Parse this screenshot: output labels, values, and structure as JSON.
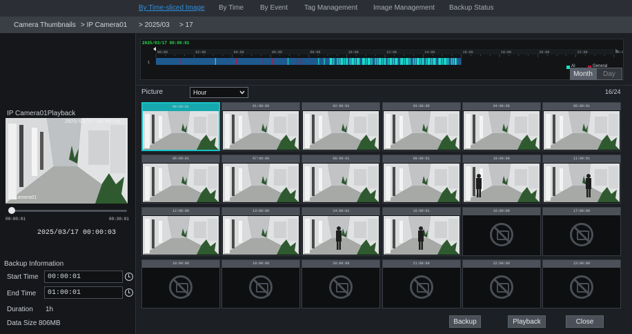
{
  "tabs": [
    "By Time-sliced Image",
    "By Time",
    "By Event",
    "Tag Management",
    "Image Management",
    "Backup Status"
  ],
  "breadcrumb": [
    "Camera Thumbnails",
    "> IP Camera01",
    "> 2025/03",
    "> 17"
  ],
  "preview": {
    "title": "IP Camera01Playback",
    "osd_time": "2025/03/17 00:00:10",
    "osd_cam": "IP Camera01",
    "progress_start": "00:00:01",
    "progress_end": "00:30:01",
    "progress_fraction": 0.0,
    "current_time": "2025/03/17 00:00:03"
  },
  "backup": {
    "heading": "Backup Information",
    "start_label": "Start Time",
    "start_value": "00:00:01",
    "end_label": "End Time",
    "end_value": "01:00:01",
    "duration_label": "Duration",
    "duration_value": "1h",
    "size_label": "Data Size",
    "size_value": "806MB"
  },
  "timeline": {
    "current_time": "2025/03/17 00:00:01",
    "hours": [
      "00:00",
      "02:00",
      "04:00",
      "06:00",
      "08:00",
      "10:00",
      "12:00",
      "14:00",
      "16:00",
      "18:00",
      "20:00",
      "22:00",
      "00:00"
    ],
    "legend_ai": "AI",
    "legend_general": "General",
    "month_label": "Month",
    "day_label": "Day",
    "colors": {
      "ai": "#19e0c8",
      "general": "#c0103a",
      "recorded": "#1f5a8f"
    }
  },
  "picture": {
    "label": "Picture",
    "select_value": "Hour",
    "count": "16/24"
  },
  "thumbnails": [
    {
      "time": "00:00:01",
      "has_image": true
    },
    {
      "time": "01:00:00",
      "has_image": true
    },
    {
      "time": "02:00:01",
      "has_image": true
    },
    {
      "time": "03:00:00",
      "has_image": true
    },
    {
      "time": "04:00:00",
      "has_image": true
    },
    {
      "time": "05:00:01",
      "has_image": true
    },
    {
      "time": "06:00:01",
      "has_image": true
    },
    {
      "time": "07:00:00",
      "has_image": true
    },
    {
      "time": "08:00:01",
      "has_image": true
    },
    {
      "time": "09:00:01",
      "has_image": true
    },
    {
      "time": "10:00:00",
      "has_image": true
    },
    {
      "time": "11:00:01",
      "has_image": true
    },
    {
      "time": "12:00:00",
      "has_image": true
    },
    {
      "time": "13:00:00",
      "has_image": true
    },
    {
      "time": "14:00:01",
      "has_image": true
    },
    {
      "time": "15:00:01",
      "has_image": true
    },
    {
      "time": "16:00:00",
      "has_image": false
    },
    {
      "time": "17:00:00",
      "has_image": false
    },
    {
      "time": "18:00:00",
      "has_image": false
    },
    {
      "time": "19:00:00",
      "has_image": false
    },
    {
      "time": "20:00:00",
      "has_image": false
    },
    {
      "time": "21:00:00",
      "has_image": false
    },
    {
      "time": "22:00:00",
      "has_image": false
    },
    {
      "time": "23:00:00",
      "has_image": false
    }
  ],
  "buttons": {
    "backup": "Backup",
    "playback": "Playback",
    "close": "Close"
  }
}
